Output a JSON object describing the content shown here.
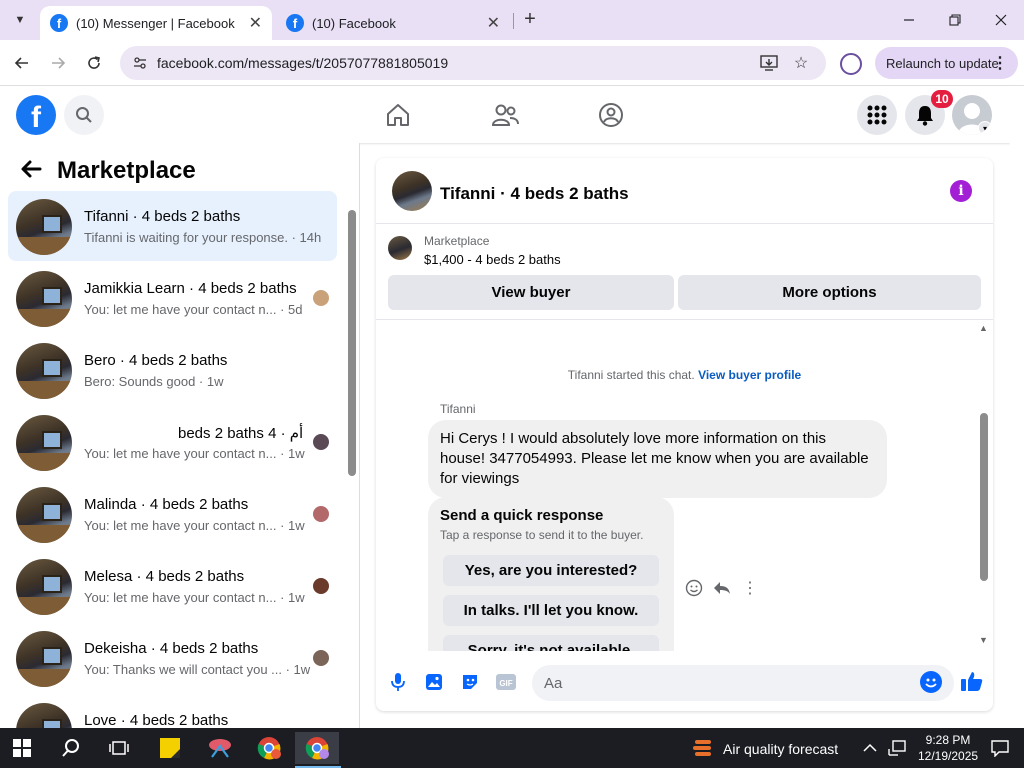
{
  "browser": {
    "tabs": [
      {
        "title": "(10) Messenger | Facebook",
        "active": true
      },
      {
        "title": "(10) Facebook",
        "active": false
      }
    ],
    "url": "facebook.com/messages/t/2057077881805019",
    "relaunch_label": "Relaunch to update"
  },
  "header": {
    "notification_count": "10"
  },
  "sidebar": {
    "title": "Marketplace",
    "conversations": [
      {
        "name": "Tifanni · 4 beds 2 baths",
        "snippet": "Tifanni is waiting for your response. · 14h",
        "selected": true
      },
      {
        "name": "Jamikkia Learn · 4 beds 2 baths",
        "snippet": "You: let me have your contact n... · 5d"
      },
      {
        "name": "Bero · 4 beds 2 baths",
        "snippet": "Bero: Sounds good · 1w"
      },
      {
        "name": "أم · 4 beds 2 baths",
        "snippet": "You: let me have your contact n... · 1w"
      },
      {
        "name": "Malinda · 4 beds 2 baths",
        "snippet": "You: let me have your contact n... · 1w"
      },
      {
        "name": "Melesa · 4 beds 2 baths",
        "snippet": "You: let me have your contact n... · 1w"
      },
      {
        "name": "Dekeisha · 4 beds 2 baths",
        "snippet": "You: Thanks we will contact you ... · 1w"
      },
      {
        "name": "Love · 4 beds 2 baths",
        "snippet": ""
      }
    ]
  },
  "chat": {
    "title": "Tifanni · 4 beds 2 baths",
    "listing_label": "Marketplace",
    "listing_price": "$1,400 - 4 beds 2 baths",
    "view_buyer": "View buyer",
    "more_options": "More options",
    "system_text": "Tifanni started this chat.",
    "system_link": "View buyer profile",
    "sender": "Tifanni",
    "message": "Hi Cerys ! I would absolutely love more information on this house! 3477054993. Please let me know when you are available for viewings",
    "quick_response": {
      "title": "Send a quick response",
      "subtitle": "Tap a response to send it to the buyer.",
      "options": [
        "Yes, are you interested?",
        "In talks. I'll let you know.",
        "Sorry, it's not available."
      ]
    },
    "composer_placeholder": "Aa"
  },
  "taskbar": {
    "weather": "Air quality forecast",
    "time": "9:28 PM",
    "date": "12/19/2025"
  },
  "colors": {
    "fb_blue": "#1877f2",
    "messenger_blue": "#0866ff",
    "selected_bg": "#e7f1fd",
    "info_purple": "#a21fd6",
    "badge_red": "#e41e3f"
  }
}
